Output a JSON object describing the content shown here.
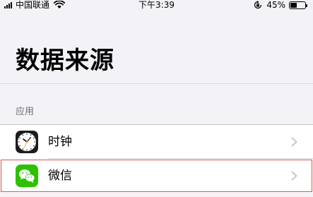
{
  "status_bar": {
    "carrier": "中国联通",
    "time": "下午3:39",
    "battery_percent_text": "45%",
    "battery_level": 0.45,
    "icons": [
      "signal-icon",
      "wifi-icon",
      "rotation-lock-icon",
      "battery-icon"
    ]
  },
  "page": {
    "title": "数据来源"
  },
  "section": {
    "header": "应用",
    "items": [
      {
        "label": "时钟",
        "icon": "clock-app-icon"
      },
      {
        "label": "微信",
        "icon": "wechat-app-icon",
        "highlighted": true
      }
    ]
  },
  "colors": {
    "background": "#f2f2f7",
    "wechat_green": "#2dc100",
    "highlight_border": "#d9534f",
    "chevron": "#c7c7cc"
  }
}
